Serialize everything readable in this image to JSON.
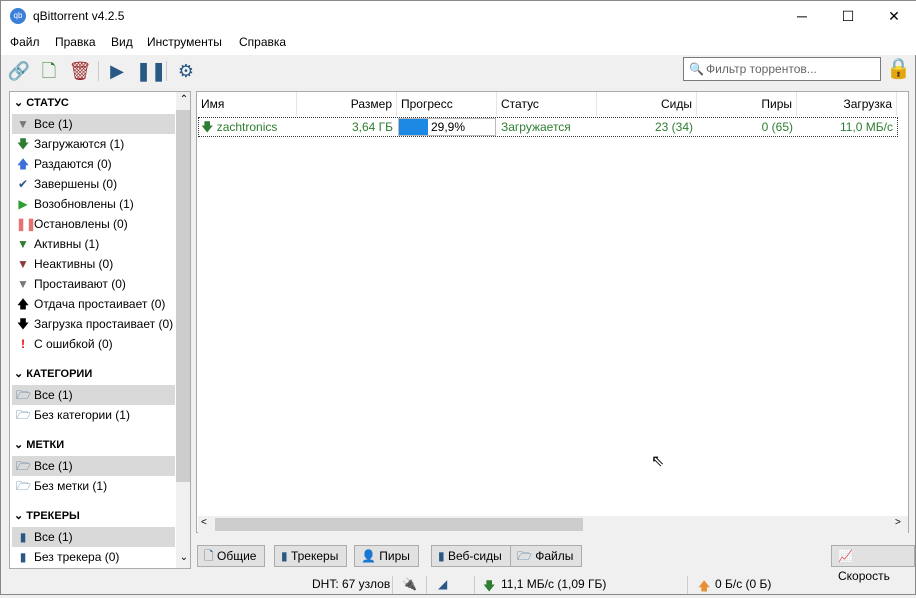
{
  "window": {
    "title": "qBittorrent v4.2.5",
    "logo": "qb",
    "minimize": "─",
    "maximize": "☐",
    "close": "✕"
  },
  "menu": [
    "Файл",
    "Правка",
    "Вид",
    "Инструменты",
    "Справка"
  ],
  "filter": {
    "placeholder": "Фильтр торрентов..."
  },
  "sidebar": {
    "status": {
      "title": "СТАТУС",
      "items": [
        "Все (1)",
        "Загружаются (1)",
        "Раздаются (0)",
        "Завершены (0)",
        "Возобновлены (1)",
        "Остановлены (0)",
        "Активны (1)",
        "Неактивны (0)",
        "Простаивают (0)",
        "Отдача простаивает (0)",
        "Загрузка простаивает (0)",
        "С ошибкой (0)"
      ]
    },
    "categories": {
      "title": "КАТЕГОРИИ",
      "items": [
        "Все (1)",
        "Без категории (1)"
      ]
    },
    "tags": {
      "title": "МЕТКИ",
      "items": [
        "Все (1)",
        "Без метки (1)"
      ]
    },
    "trackers": {
      "title": "ТРЕКЕРЫ",
      "items": [
        "Все (1)",
        "Без трекера (0)"
      ]
    }
  },
  "table": {
    "headers": [
      "Имя",
      "Размер",
      "Прогресс",
      "Статус",
      "Сиды",
      "Пиры",
      "Загрузка"
    ],
    "rows": [
      {
        "name": "zachtronics",
        "size": "3,64 ГБ",
        "progress_text": "29,9%",
        "progress": 0.299,
        "status": "Загружается",
        "seeds": "23 (34)",
        "peers": "0 (65)",
        "down": "11,0 МБ/с"
      }
    ]
  },
  "tabs": [
    "Общие",
    "Трекеры",
    "Пиры",
    "Веб-сиды",
    "Файлы"
  ],
  "speed_button": "Скорость",
  "status": {
    "dht": "DHT: 67 узлов",
    "download": "11,1 МБ/с (1,09 ГБ)",
    "upload": "0 Б/с (0 Б)"
  },
  "colors": {
    "accent": "#1e88e5",
    "green": "#2e7d32"
  }
}
